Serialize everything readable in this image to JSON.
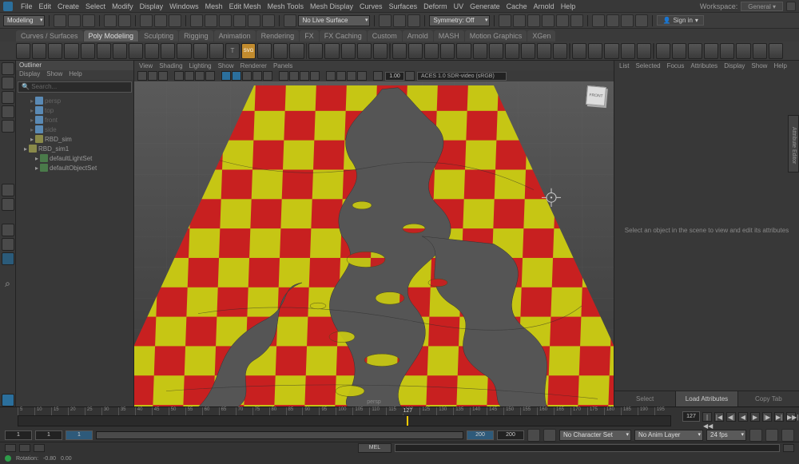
{
  "menubar": [
    "File",
    "Edit",
    "Create",
    "Select",
    "Modify",
    "Display",
    "Windows",
    "Mesh",
    "Edit Mesh",
    "Mesh Tools",
    "Mesh Display",
    "Curves",
    "Surfaces",
    "Deform",
    "UV",
    "Generate",
    "Cache",
    "Arnold",
    "Help"
  ],
  "workspace": {
    "label": "Workspace:",
    "value": "General"
  },
  "toolbar1": {
    "mode": "Modeling",
    "no_live": "No Live Surface",
    "symmetry": "Symmetry: Off",
    "signin": "Sign in"
  },
  "tabs": [
    "Curves / Surfaces",
    "Poly Modeling",
    "Sculpting",
    "Rigging",
    "Animation",
    "Rendering",
    "FX",
    "FX Caching",
    "Custom",
    "Arnold",
    "MASH",
    "Motion Graphics",
    "XGen"
  ],
  "activeTab": 1,
  "outliner": {
    "title": "Outliner",
    "menu": [
      "Display",
      "Show",
      "Help"
    ],
    "search": "Search...",
    "items": [
      {
        "label": "persp",
        "dim": true,
        "pad": 14,
        "ic": "b"
      },
      {
        "label": "top",
        "dim": true,
        "pad": 14,
        "ic": "b"
      },
      {
        "label": "front",
        "dim": true,
        "pad": 14,
        "ic": "b"
      },
      {
        "label": "side",
        "dim": true,
        "pad": 14,
        "ic": "b"
      },
      {
        "label": "RBD_sim",
        "dim": false,
        "pad": 14,
        "ic": "y"
      },
      {
        "label": "RBD_sim1",
        "dim": false,
        "pad": 6,
        "ic": "y"
      },
      {
        "label": "defaultLightSet",
        "dim": false,
        "pad": 20,
        "ic": "g"
      },
      {
        "label": "defaultObjectSet",
        "dim": false,
        "pad": 20,
        "ic": "g"
      }
    ]
  },
  "viewport": {
    "menu": [
      "View",
      "Shading",
      "Lighting",
      "Show",
      "Renderer",
      "Panels"
    ],
    "num": "1.00",
    "colorspace": "ACES 1.0 SDR-video (sRGB)",
    "persp": "persp",
    "cube": "FRONT"
  },
  "right": {
    "menu": [
      "List",
      "Selected",
      "Focus",
      "Attributes",
      "Display",
      "Show",
      "Help"
    ],
    "msg": "Select an object in the scene to view and edit its attributes",
    "btns": [
      "Select",
      "Load Attributes",
      "Copy Tab"
    ],
    "sidetab": "Attribute Editor"
  },
  "timeline": {
    "ticks": [
      "5",
      "10",
      "15",
      "20",
      "25",
      "30",
      "35",
      "40",
      "45",
      "50",
      "55",
      "60",
      "65",
      "70",
      "75",
      "80",
      "85",
      "90",
      "95",
      "100",
      "105",
      "110",
      "115",
      "120",
      "125",
      "130",
      "135",
      "140",
      "145",
      "150",
      "155",
      "160",
      "165",
      "170",
      "175",
      "180",
      "185",
      "190",
      "195"
    ],
    "current": "127",
    "field": "127"
  },
  "range": {
    "start": "1",
    "end": "1",
    "innerStart": "1",
    "rangeEnd": "200",
    "totalEnd": "200",
    "charset": "No Character Set",
    "animlayer": "No Anim Layer",
    "fps": "24 fps"
  },
  "mel": "MEL",
  "status": {
    "tool": "Rotation:",
    "v1": "-0.80",
    "v2": "0.00"
  },
  "play": [
    "|◀◀",
    "|◀",
    "◀|",
    "◀",
    "▶",
    "|▶",
    "▶|",
    "▶▶|"
  ]
}
